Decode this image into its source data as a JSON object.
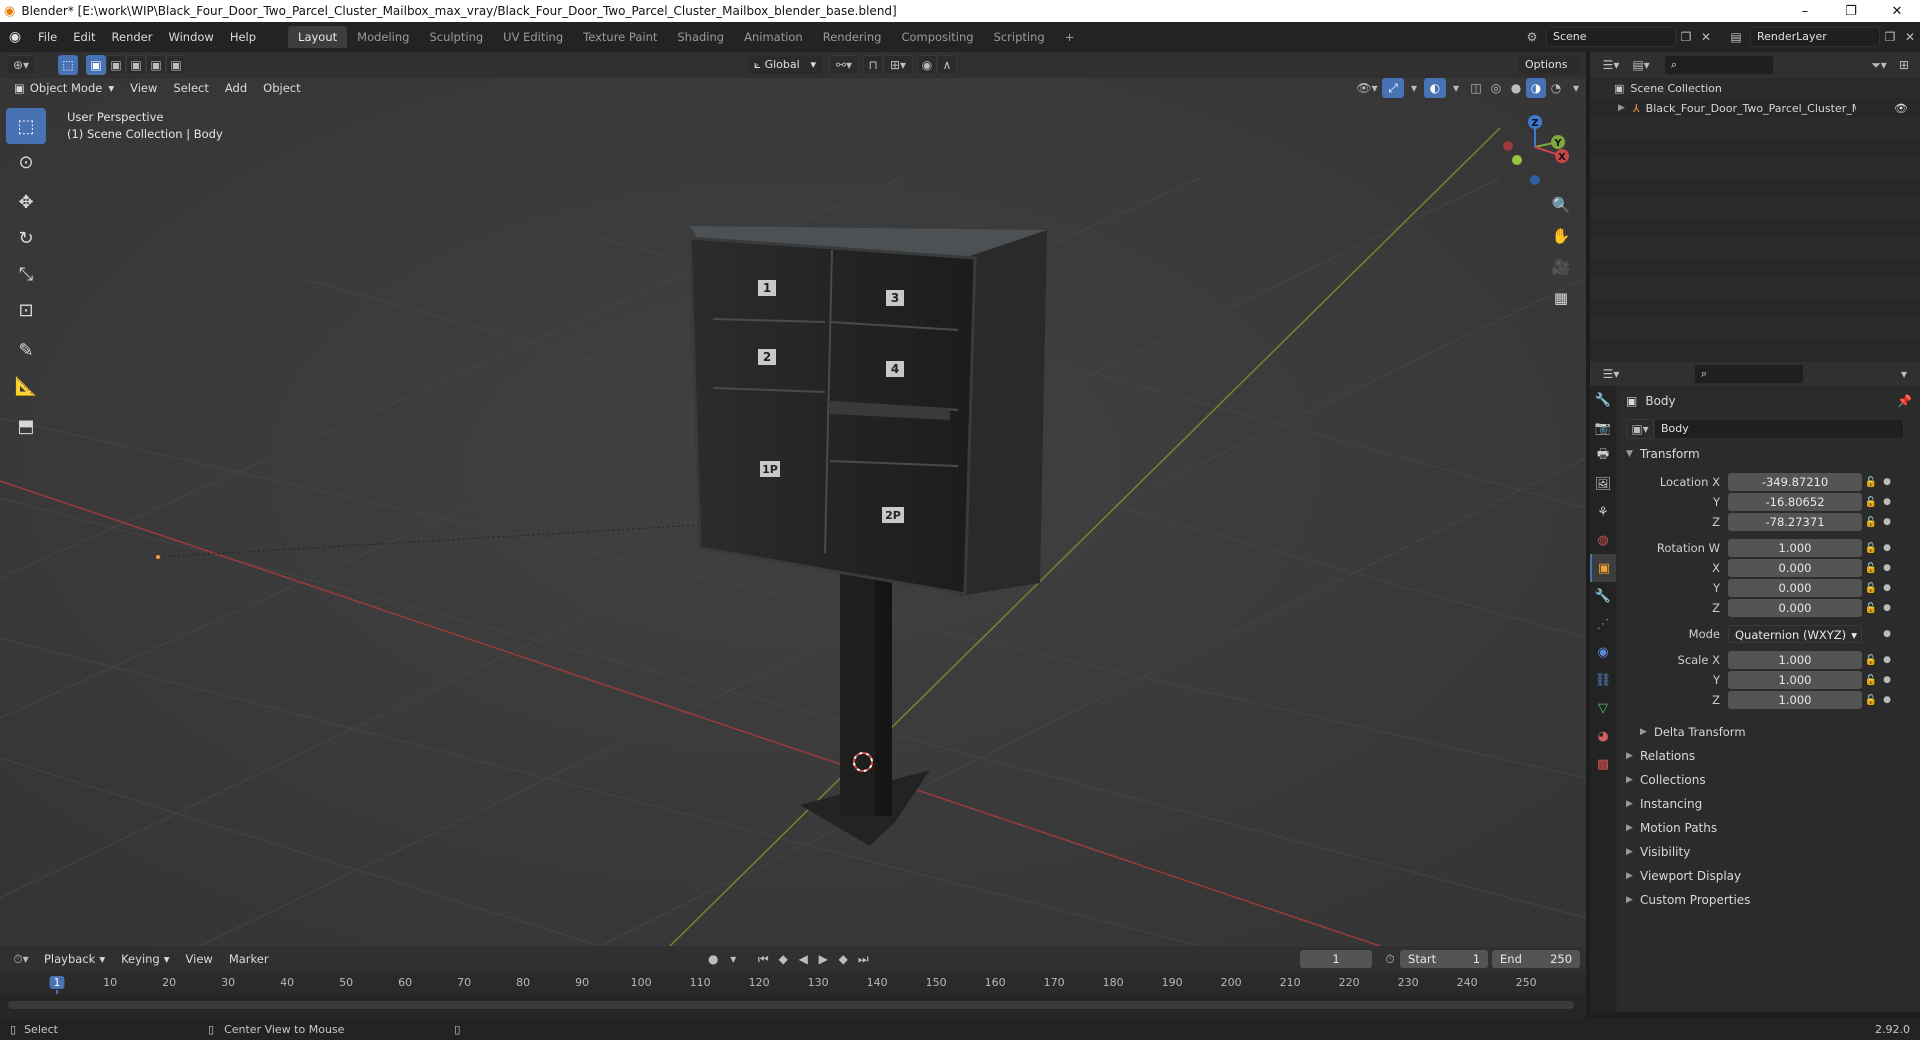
{
  "window": {
    "title": "Blender* [E:\\work\\WIP\\Black_Four_Door_Two_Parcel_Cluster_Mailbox_max_vray/Black_Four_Door_Two_Parcel_Cluster_Mailbox_blender_base.blend]",
    "minimize": "–",
    "maximize": "❐",
    "close": "✕"
  },
  "menu": [
    "File",
    "Edit",
    "Render",
    "Window",
    "Help"
  ],
  "workspaces": [
    "Layout",
    "Modeling",
    "Sculpting",
    "UV Editing",
    "Texture Paint",
    "Shading",
    "Animation",
    "Rendering",
    "Compositing",
    "Scripting"
  ],
  "workspace_add": "+",
  "scene": {
    "name": "Scene",
    "renderlayer": "RenderLayer"
  },
  "viewport_header": {
    "transform_orientation": "Global",
    "options": "Options"
  },
  "viewport_menu": {
    "mode": "Object Mode",
    "items": [
      "View",
      "Select",
      "Add",
      "Object"
    ]
  },
  "viewport_overlay": {
    "line1": "User Perspective",
    "line2": "(1) Scene Collection | Body"
  },
  "gizmo": {
    "z": "Z",
    "y": "Y",
    "x": "X"
  },
  "mailbox": {
    "door_labels": [
      "1",
      "2",
      "3",
      "4",
      "1P",
      "2P"
    ]
  },
  "outliner": {
    "root": "Scene Collection",
    "item": "Black_Four_Door_Two_Parcel_Cluster_Mailbox"
  },
  "properties": {
    "object_name": "Body",
    "object_field": "Body",
    "transform_title": "Transform",
    "location": {
      "label_x": "Location X",
      "label_y": "Y",
      "label_z": "Z",
      "x": "-349.87210",
      "y": "-16.80652",
      "z": "-78.27371"
    },
    "rotation": {
      "label_w": "Rotation W",
      "label_x": "X",
      "label_y": "Y",
      "label_z": "Z",
      "w": "1.000",
      "x": "0.000",
      "y": "0.000",
      "z": "0.000"
    },
    "mode": {
      "label": "Mode",
      "value": "Quaternion (WXYZ)"
    },
    "scale": {
      "label_x": "Scale X",
      "label_y": "Y",
      "label_z": "Z",
      "x": "1.000",
      "y": "1.000",
      "z": "1.000"
    },
    "delta": "Delta Transform",
    "panels": [
      "Relations",
      "Collections",
      "Instancing",
      "Motion Paths",
      "Visibility",
      "Viewport Display",
      "Custom Properties"
    ]
  },
  "timeline": {
    "menu": [
      "Playback",
      "Keying",
      "View",
      "Marker"
    ],
    "current_frame": "1",
    "start_label": "Start",
    "start": "1",
    "end_label": "End",
    "end": "250",
    "ticks": [
      "1",
      "10",
      "20",
      "30",
      "40",
      "50",
      "60",
      "70",
      "80",
      "90",
      "100",
      "110",
      "120",
      "130",
      "140",
      "150",
      "160",
      "170",
      "180",
      "190",
      "200",
      "210",
      "220",
      "230",
      "240",
      "250"
    ]
  },
  "status": {
    "select": "Select",
    "center_view": "Center View to Mouse",
    "version": "2.92.0"
  },
  "colors": {
    "accent": "#4772b3",
    "x_axis": "#c8464a",
    "y_axis": "#7ea83a",
    "z_axis": "#3e7ad3"
  }
}
